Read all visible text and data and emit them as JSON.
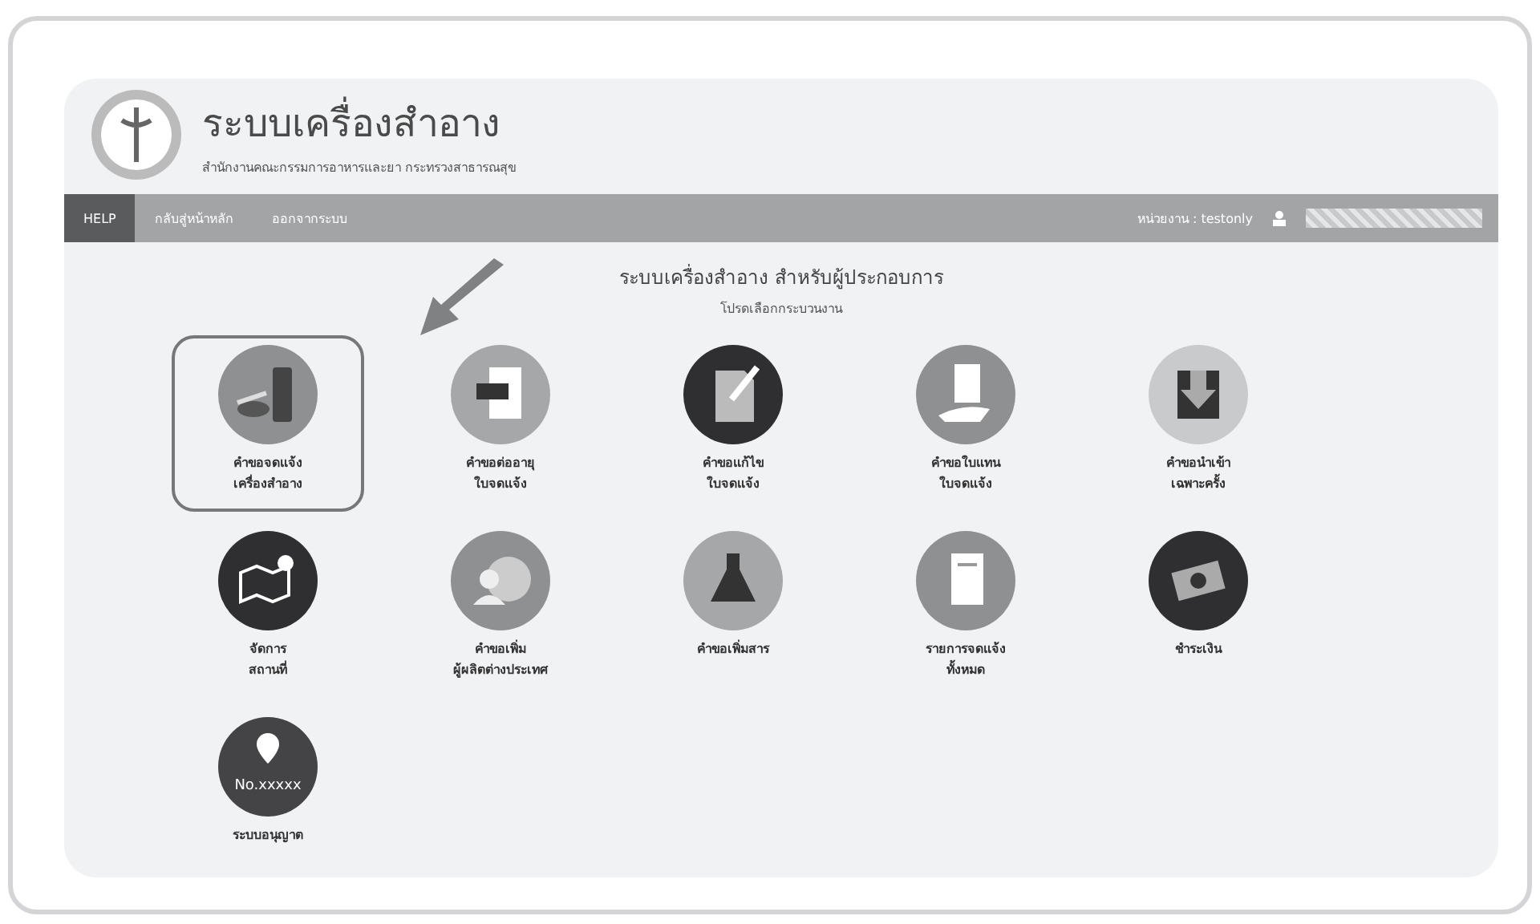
{
  "header": {
    "title": "ระบบเครื่องสำอาง",
    "subtitle": "สำนักงานคณะกรรมการอาหารและยา กระทรวงสาธารณสุข"
  },
  "nav": {
    "items": [
      {
        "label": "HELP",
        "selected": true
      },
      {
        "label": "กลับสู่หน้าหลัก",
        "selected": false
      },
      {
        "label": "ออกจากระบบ",
        "selected": false
      }
    ],
    "agency": "หน่วยงาน : testonly"
  },
  "content": {
    "heading": "ระบบเครื่องสำอาง สำหรับผู้ประกอบการ",
    "subheading": "โปรดเลือกกระบวนงาน",
    "services": [
      {
        "label": "คำขอจดแจ้ง\nเครื่องสำอาง",
        "selected": true
      },
      {
        "label": "คำขอต่ออายุ\nใบจดแจ้ง",
        "selected": false
      },
      {
        "label": "คำขอแก้ไข\nใบจดแจ้ง",
        "selected": false
      },
      {
        "label": "คำขอใบแทน\nใบจดแจ้ง",
        "selected": false
      },
      {
        "label": "คำขอนำเข้า\nเฉพาะครั้ง",
        "selected": false
      },
      {
        "label": "จัดการ\nสถานที่",
        "selected": false
      },
      {
        "label": "คำขอเพิ่ม\nผู้ผลิตต่างประเทศ",
        "selected": false
      },
      {
        "label": "คำขอเพิ่มสาร",
        "selected": false
      },
      {
        "label": "รายการจดแจ้ง\nทั้งหมด",
        "selected": false
      },
      {
        "label": "ชำระเงิน",
        "selected": false
      },
      {
        "label": "ระบบอนุญาต",
        "selected": false,
        "icon_text": "No.xxxxx"
      }
    ]
  }
}
